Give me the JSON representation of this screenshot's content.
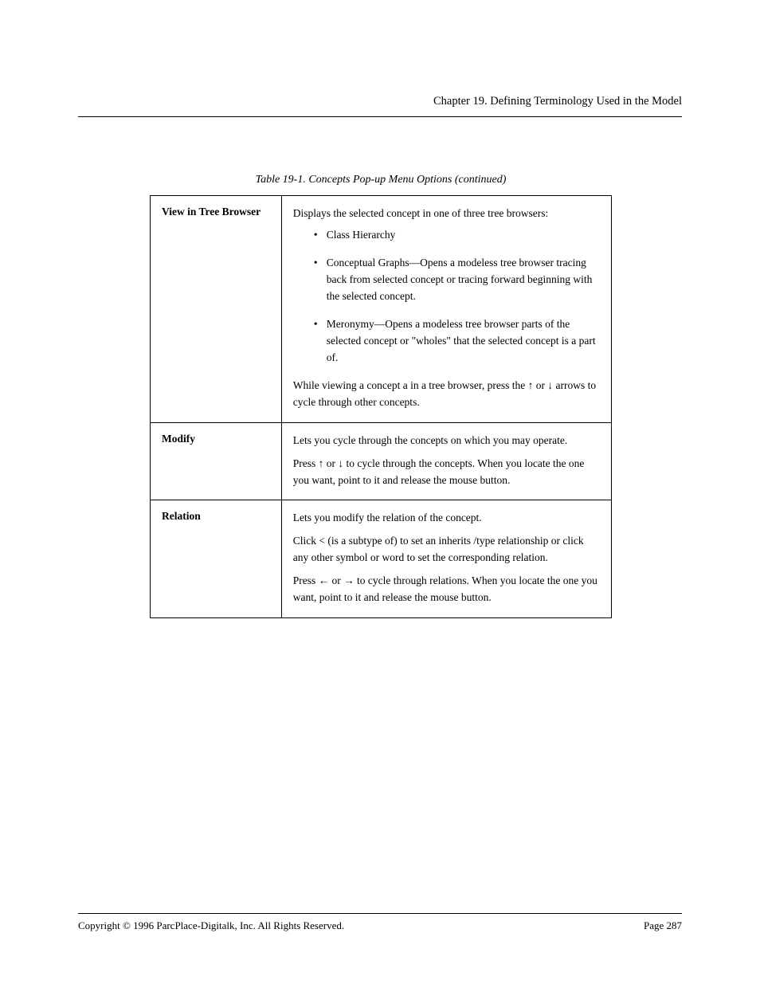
{
  "header": {
    "chapter": "Chapter 19. Defining Terminology Used in the Model"
  },
  "tableTitle": "Table 19-1. Concepts Pop-up Menu Options (continued)",
  "rows": [
    {
      "title": "View in Tree Browser",
      "intro": "Displays the selected concept in one of three tree browsers:",
      "bullets": [
        "Class Hierarchy",
        "Conceptual Graphs—Opens a modeless tree browser tracing back from selected concept or tracing forward beginning with the selected concept.",
        "Meronymy—Opens a modeless tree browser parts of the selected concept or \"wholes\" that the selected concept is a part of."
      ],
      "tail": "While viewing a concept a in a tree browser, press the ↑ or ↓ arrows to cycle through other concepts."
    },
    {
      "title": "Modify",
      "paras": [
        "Lets you cycle through the concepts on which you may operate.",
        "Press ↑ or ↓ to cycle through the concepts. When you locate the one you want, point to it and release the mouse button."
      ]
    },
    {
      "title": "Relation",
      "paras": [
        "Lets you modify the relation of the concept.",
        "Click < (is a subtype of) to set an inherits /type relationship or click any other symbol or word to set the corresponding relation.",
        "Press ← or → to cycle through relations. When you locate the one you want, point to it and release the mouse button."
      ]
    }
  ],
  "footer": {
    "left": "Copyright © 1996 ParcPlace-Digitalk, Inc. All Rights Reserved.",
    "right": "Page 287"
  }
}
